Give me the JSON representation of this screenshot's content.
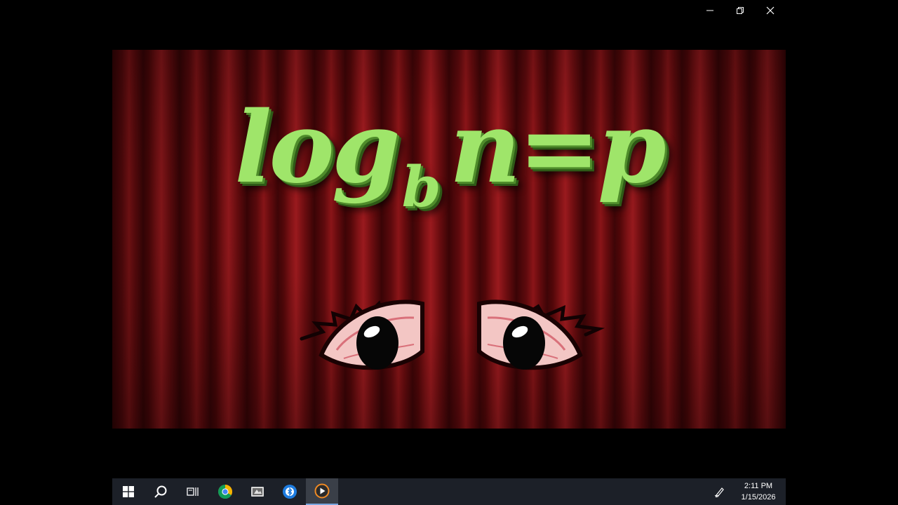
{
  "window": {
    "controls": [
      "minimize-icon",
      "restore-icon",
      "close-icon"
    ]
  },
  "video": {
    "equation": {
      "main_left": "log",
      "subscript": "b",
      "main_right": "n=p"
    },
    "colors": {
      "text": "#9fe56a",
      "curtain": "#7e1215"
    }
  },
  "taskbar": {
    "apps": [
      "windows-start-icon",
      "search-icon",
      "task-view-icon",
      "chrome-icon",
      "media-app-icon",
      "bluetooth-app-icon",
      "media-player-icon"
    ],
    "active_app": "media-player-icon",
    "clock": {
      "time": "2:11 PM",
      "date": "1/15/2026"
    },
    "tray": [
      "pen-icon"
    ]
  }
}
